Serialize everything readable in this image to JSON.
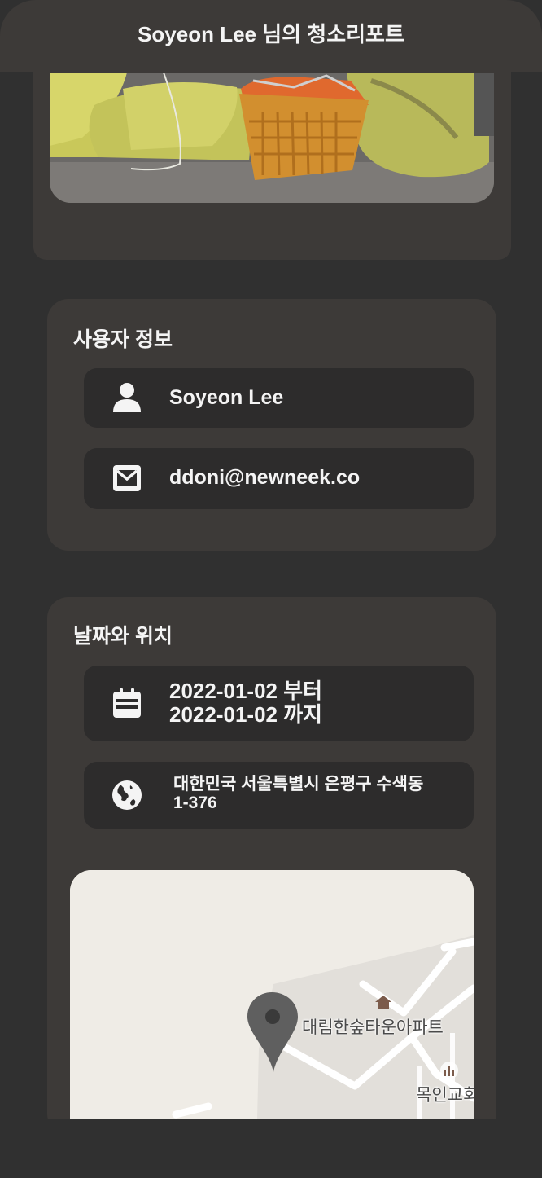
{
  "header": {
    "title": "Soyeon Lee 님의 청소리포트"
  },
  "user_info": {
    "title": "사용자 정보",
    "name": "Soyeon Lee",
    "email": "ddoni@newneek.co",
    "name_icon": "person-icon",
    "email_icon": "mail-icon"
  },
  "date_location": {
    "title": "날짜와 위치",
    "date_from": "2022-01-02 부터",
    "date_to": "2022-01-02 까지",
    "address_line1": "대한민국 서울특별시 은평구 수색동",
    "address_line2": "1-376",
    "date_icon": "calendar-icon",
    "location_icon": "globe-icon"
  },
  "map": {
    "place_1": "대림한숲타운아파트",
    "place_2": "목인교회",
    "marker_icon": "map-pin-icon"
  },
  "colors": {
    "background": "#303030",
    "card": "#3d3a38",
    "row": "#2d2c2c",
    "text": "#f4f4f4",
    "map": "#efece6"
  }
}
